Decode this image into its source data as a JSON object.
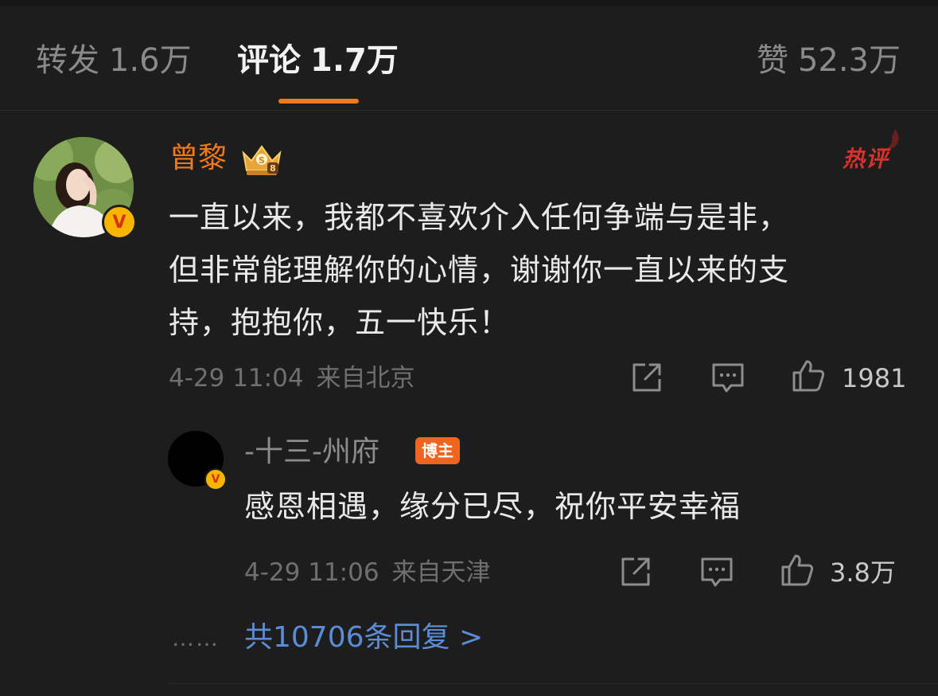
{
  "tabs": {
    "repost_label": "转发",
    "repost_count": "1.6万",
    "comments_label": "评论",
    "comments_count": "1.7万",
    "likes_label": "赞",
    "likes_count": "52.3万",
    "active_tab": "comments",
    "accent_color": "#f07a1a"
  },
  "comment": {
    "username": "曾黎",
    "verified": true,
    "badge_icon": "crown-icon",
    "hot_label": "热评",
    "lines": [
      "一直以来，我都不喜欢介入任何争端与是非，",
      "但非常能理解你的心情，谢谢你一直以来的支",
      "持，抱抱你，五一快乐！"
    ],
    "time": "4-29 11:04",
    "location": "来自北京",
    "likes": "1981"
  },
  "reply": {
    "username": "-十三-州府",
    "verified": true,
    "badge": "博主",
    "text": "感恩相遇，缘分已尽，祝你平安幸福",
    "time": "4-29 11:06",
    "location": "来自天津",
    "likes": "3.8万"
  },
  "more_replies": {
    "dots": "……",
    "label": "共10706条回复 >",
    "link_color": "#5b8cd6"
  },
  "icons": {
    "share": "share-icon",
    "comment": "comment-icon",
    "like": "thumbs-up-icon"
  }
}
